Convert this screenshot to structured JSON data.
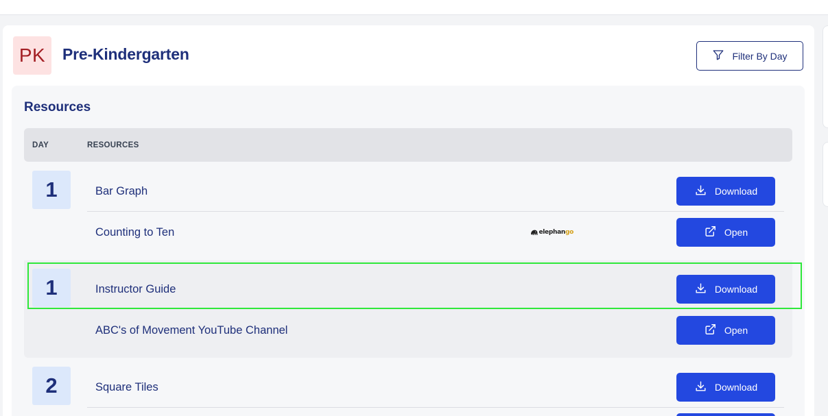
{
  "header": {
    "badge": "PK",
    "title": "Pre-Kindergarten",
    "filter_label": "Filter By Day"
  },
  "section": {
    "title": "Resources",
    "columns": {
      "day": "DAY",
      "resources": "RESOURCES"
    }
  },
  "groups": [
    {
      "day": "1",
      "rows": [
        {
          "label": "Bar Graph",
          "action": "Download",
          "icon": "download-icon"
        },
        {
          "label": "Counting to Ten",
          "action": "Open",
          "icon": "external-link-icon",
          "partner_logo": "elephango"
        }
      ]
    },
    {
      "day": "1",
      "rows": [
        {
          "label": "Instructor Guide",
          "action": "Download",
          "icon": "download-icon"
        },
        {
          "label": "ABC's of Movement YouTube Channel",
          "action": "Open",
          "icon": "external-link-icon"
        }
      ]
    },
    {
      "day": "2",
      "rows": [
        {
          "label": "Square Tiles",
          "action": "Download",
          "icon": "download-icon"
        }
      ]
    }
  ],
  "logo": {
    "part1": "elephan",
    "part2": "go"
  },
  "colors": {
    "primary": "#2348e0",
    "navy": "#1e2f7a",
    "badge_bg": "#fde2e2",
    "badge_text": "#a31f24",
    "day_bg": "#dce8fb",
    "highlight": "#2ee83a"
  }
}
